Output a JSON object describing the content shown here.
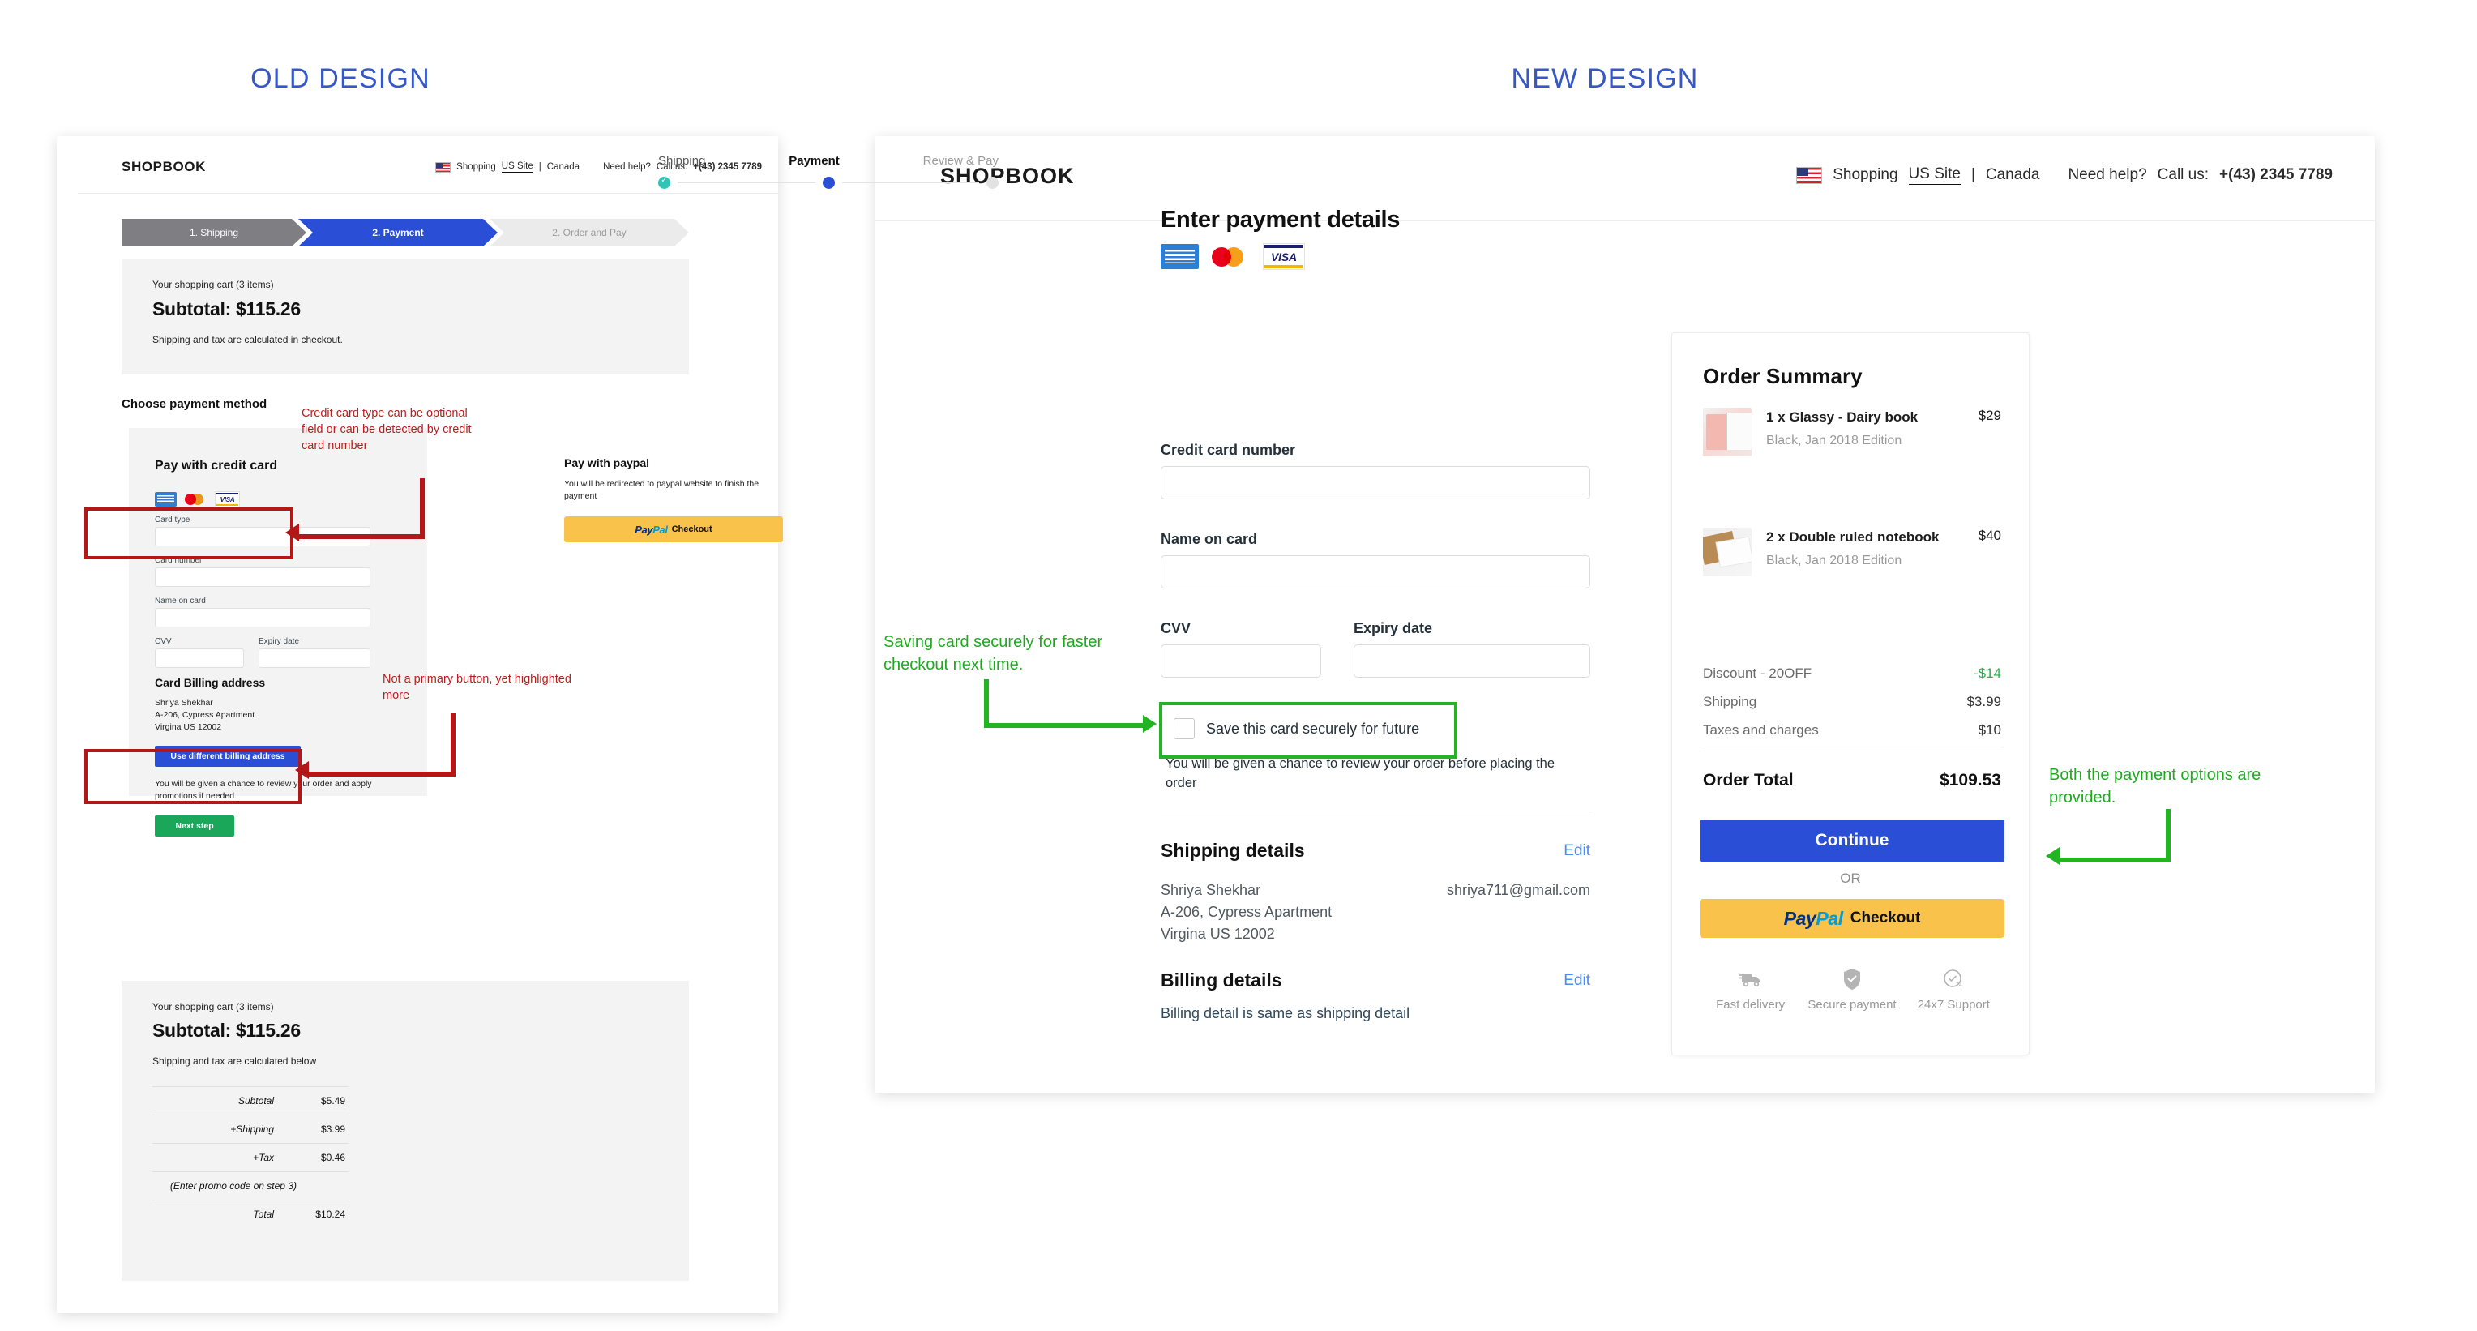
{
  "page": {
    "old_title": "OLD DESIGN",
    "new_title": "NEW DESIGN",
    "accent_blue": "#3558c6",
    "annotation_red": "#bb1e1e",
    "annotation_green": "#1faa22"
  },
  "brand": {
    "logo": "SHOPBOOK"
  },
  "topbar": {
    "shopping_label": "Shopping",
    "us_site": "US Site",
    "divider": "|",
    "canada": "Canada",
    "need_help": "Need help?",
    "call_us_label": "Call us:",
    "phone": "+(43) 2345 7789",
    "flag_icon": "us-flag-icon"
  },
  "old": {
    "steps": [
      {
        "label": "1. Shipping",
        "state": "done"
      },
      {
        "label": "2. Payment",
        "state": "current"
      },
      {
        "label": "2. Order and Pay",
        "state": "future"
      }
    ],
    "cart_top": {
      "items_label": "Your shopping cart (3 items)",
      "subtotal": "Subtotal: $115.26",
      "note": "Shipping and tax are calculated in checkout."
    },
    "choose_payment": "Choose payment method",
    "credit_card": {
      "title": "Pay with credit card",
      "card_icons": [
        "amex-icon",
        "mastercard-icon",
        "visa-icon"
      ],
      "fields": [
        {
          "label": "Card type",
          "value": ""
        },
        {
          "label": "Card number",
          "value": ""
        },
        {
          "label": "Name on card",
          "value": ""
        },
        {
          "label": "CVV",
          "value": ""
        },
        {
          "label": "Expiry date",
          "value": ""
        }
      ],
      "billing_title": "Card Billing address",
      "billing_address": [
        "Shriya Shekhar",
        "A-206, Cypress Apartment",
        "Virgina US 12002"
      ],
      "billing_button": "Use different billing address",
      "review_note": "You will be given a chance to review your order and apply promotions if needed.",
      "next_button": "Next step"
    },
    "paypal": {
      "title": "Pay with paypal",
      "note": "You will be redirected to  paypal website to finish the payment",
      "button_brand_1": "Pay",
      "button_brand_2": "Pal",
      "button_label": "Checkout"
    },
    "cart_bottom": {
      "items_label": "Your shopping cart (3 items)",
      "subtotal": "Subtotal: $115.26",
      "note": "Shipping and tax are calculated below",
      "rows": [
        {
          "key": "Subtotal",
          "value": "$5.49"
        },
        {
          "key": "+Shipping",
          "value": "$3.99"
        },
        {
          "key": "+Tax",
          "value": "$0.46"
        },
        {
          "key": "(Enter promo code on step 3)",
          "value": ""
        },
        {
          "key": "Total",
          "value": "$10.24"
        }
      ]
    },
    "annotations": [
      "Credit card type can be optional field or can be detected by credit card number",
      "Not a primary button, yet highlighted more"
    ]
  },
  "new": {
    "steps": [
      {
        "label": "Shipping",
        "state": "done"
      },
      {
        "label": "Payment",
        "state": "current"
      },
      {
        "label": "Review & Pay",
        "state": "future"
      }
    ],
    "payment": {
      "title": "Enter payment details",
      "card_icons": [
        "amex-icon",
        "mastercard-icon",
        "visa-icon"
      ],
      "fields": [
        {
          "label": "Credit card number",
          "value": ""
        },
        {
          "label": "Name on card",
          "value": ""
        },
        {
          "label": "CVV",
          "value": ""
        },
        {
          "label": "Expiry date",
          "value": ""
        }
      ],
      "save_card_label": "Save this card securely for future",
      "save_card_checked": false,
      "review_note": "You will be given a chance to review your order before placing the order"
    },
    "shipping_details": {
      "title": "Shipping details",
      "edit": "Edit",
      "lines": [
        "Shriya Shekhar",
        "A-206, Cypress Apartment",
        "Virgina US 12002"
      ],
      "email": "shriya711@gmail.com"
    },
    "billing_details": {
      "title": "Billing details",
      "edit": "Edit",
      "text": "Billing detail is same as shipping detail"
    },
    "summary": {
      "title": "Order Summary",
      "items": [
        {
          "name": "1 x Glassy - Dairy book",
          "variant": "Black, Jan 2018 Edition",
          "price": "$29"
        },
        {
          "name": "2 x Double ruled notebook",
          "variant": "Black, Jan 2018 Edition",
          "price": "$40"
        }
      ],
      "lines": [
        {
          "key": "Discount - 20OFF",
          "value": "-$14",
          "highlight": true
        },
        {
          "key": "Shipping",
          "value": "$3.99",
          "highlight": false
        },
        {
          "key": "Taxes and charges",
          "value": "$10",
          "highlight": false
        }
      ],
      "total_label": "Order Total",
      "total_value": "$109.53",
      "continue_button": "Continue",
      "or_label": "OR",
      "paypal_brand_1": "Pay",
      "paypal_brand_2": "Pal",
      "paypal_label": "Checkout",
      "badges": [
        {
          "icon": "truck-icon",
          "label": "Fast delivery"
        },
        {
          "icon": "shield-check-icon",
          "label": "Secure payment"
        },
        {
          "icon": "clock-24-icon",
          "label": "24x7 Support"
        }
      ]
    },
    "annotations": [
      "Saving card securely for faster checkout next time.",
      "Both the payment options are provided."
    ]
  }
}
